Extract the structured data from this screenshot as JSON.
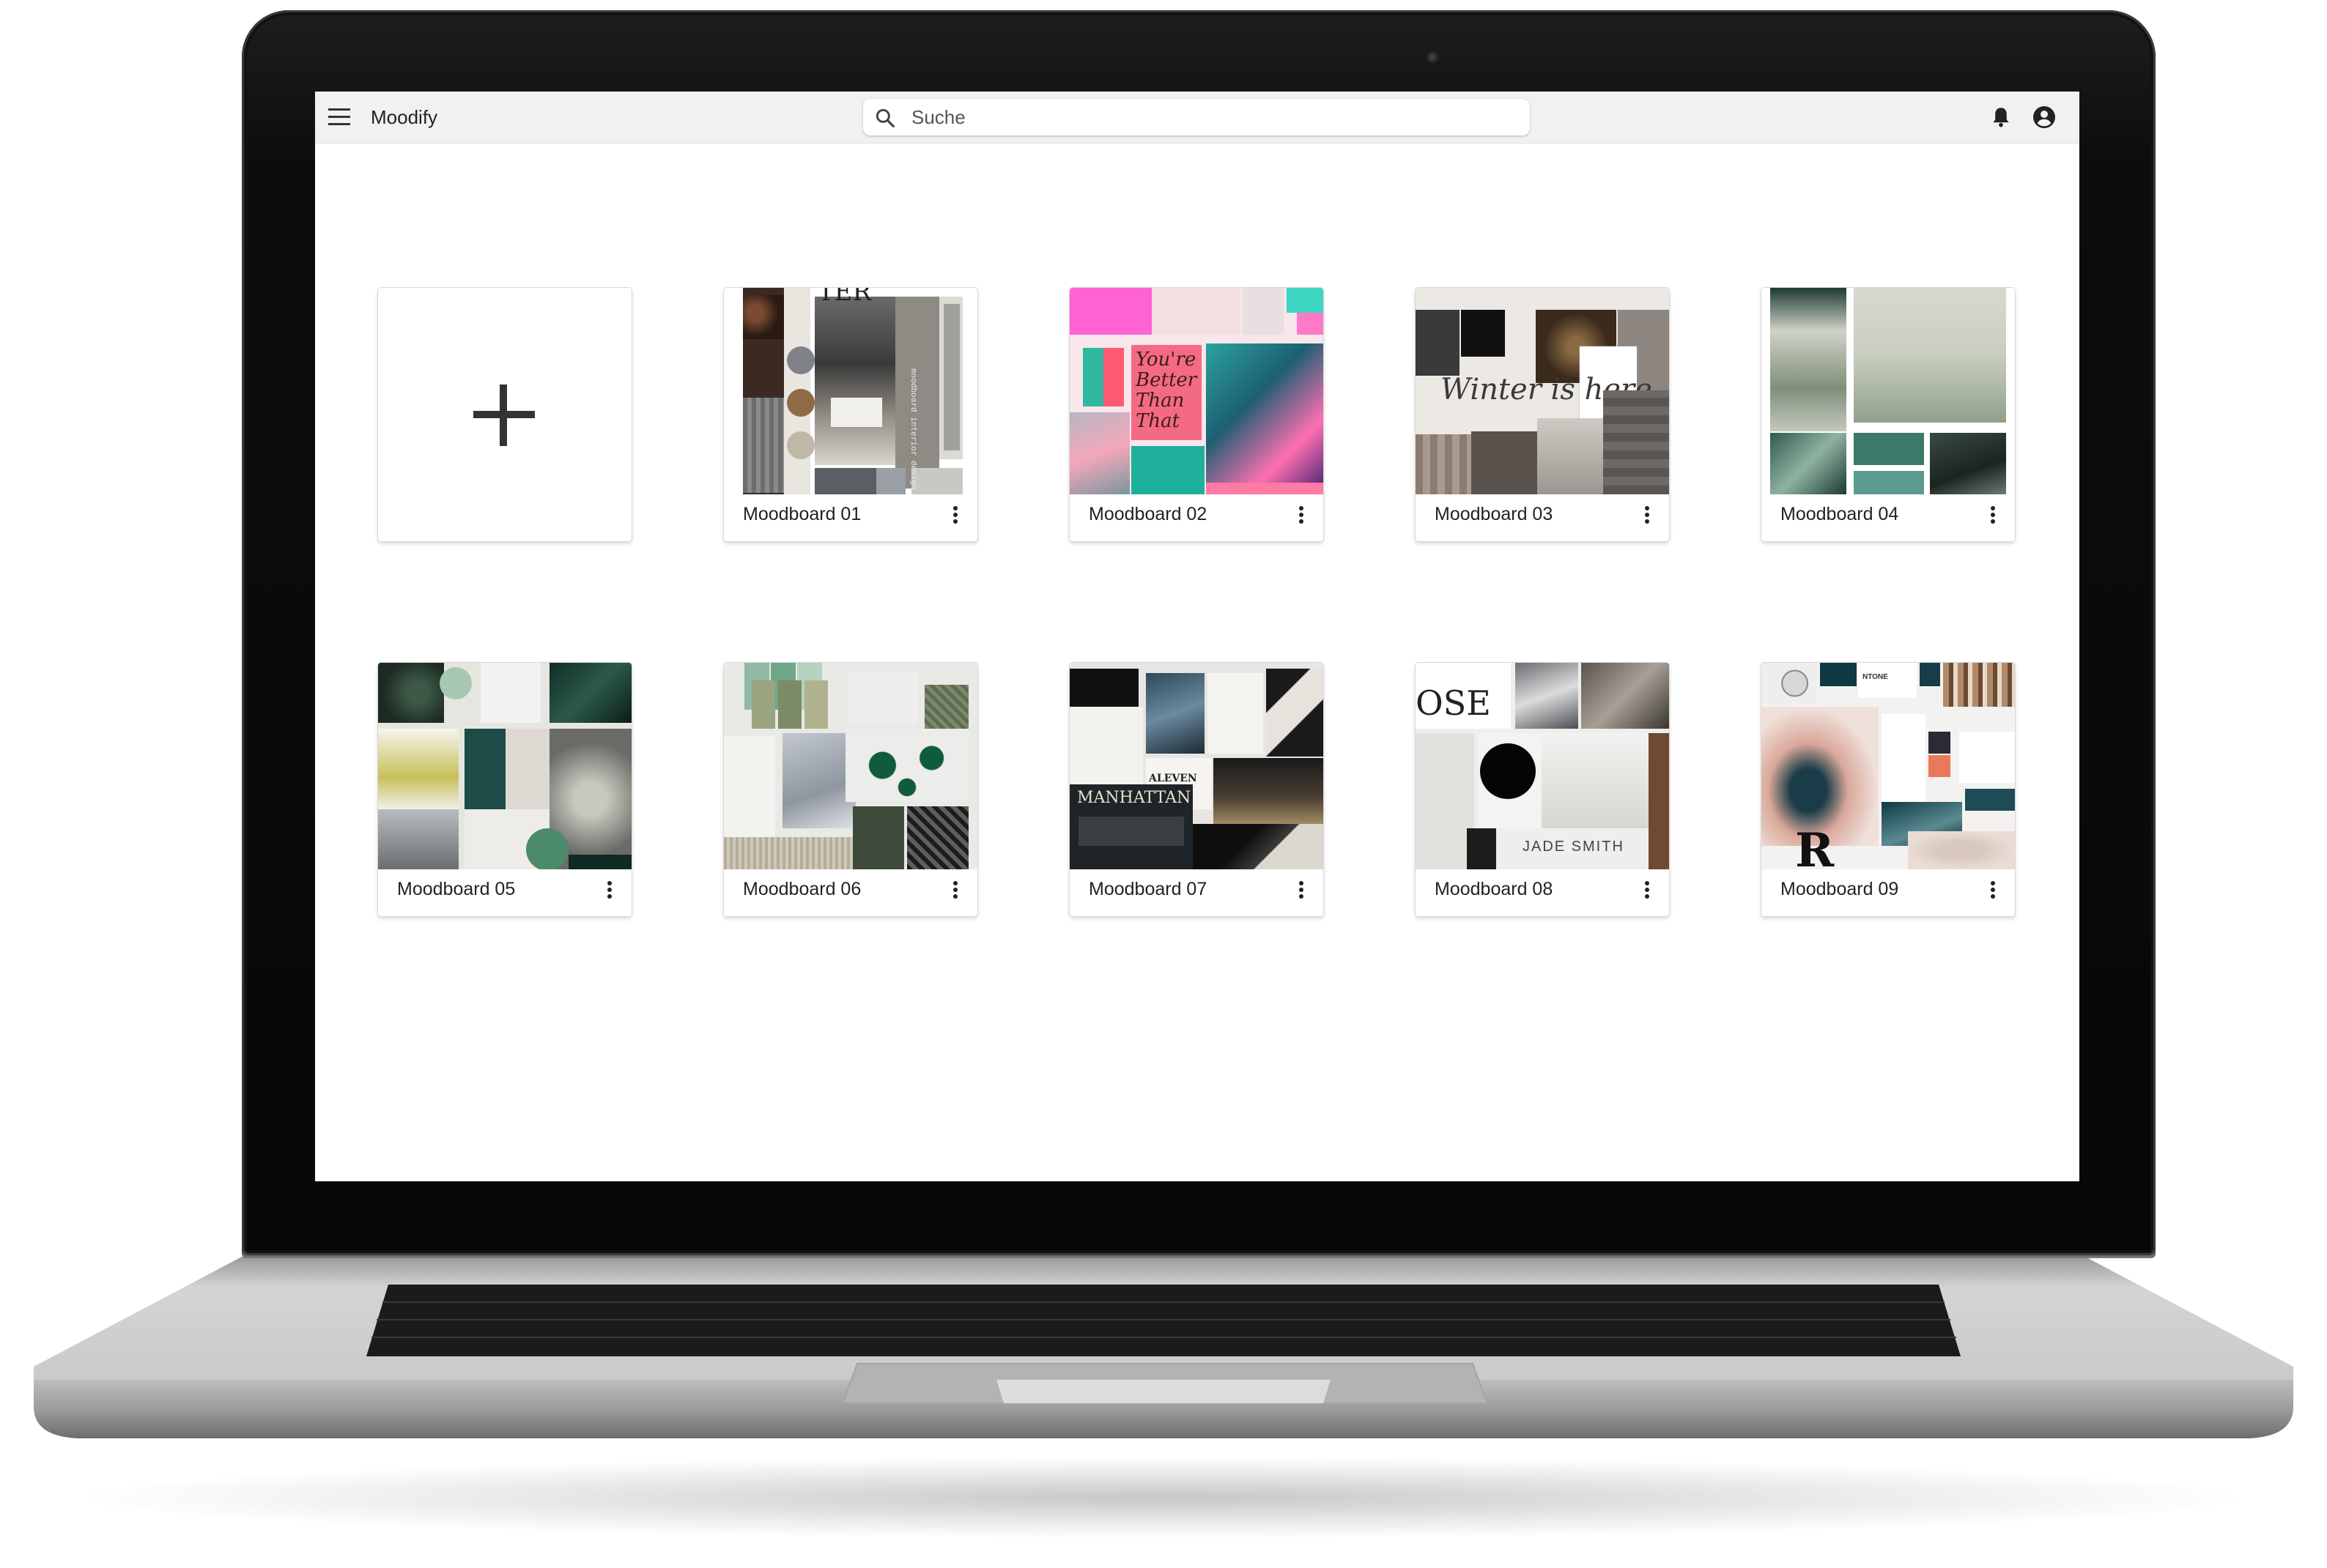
{
  "app": {
    "title": "Moodify"
  },
  "search": {
    "placeholder": "Suche"
  },
  "icons": {
    "menu": "menu-icon",
    "search": "search-icon",
    "notifications": "bell-icon",
    "account": "account-circle-icon",
    "add": "plus-icon",
    "card_menu": "more-vertical-icon"
  },
  "cards": [
    {
      "label": "Moodboard 01",
      "thumb_text": "TER",
      "side_text": "moodboard interior design"
    },
    {
      "label": "Moodboard 02",
      "thumb_text": "You're Better Than That"
    },
    {
      "label": "Moodboard 03",
      "thumb_text": "Winter is here"
    },
    {
      "label": "Moodboard 04"
    },
    {
      "label": "Moodboard 05"
    },
    {
      "label": "Moodboard 06"
    },
    {
      "label": "Moodboard 07",
      "thumb_text": "MANHATTAN",
      "thumb_text_2": "ALEVEN"
    },
    {
      "label": "Moodboard 08",
      "thumb_text": "OSE",
      "thumb_text_2": "JADE SMITH"
    },
    {
      "label": "Moodboard 09",
      "thumb_text": "R",
      "thumb_text_2": "NTONE"
    }
  ],
  "colors": {
    "appbar": "#f1f1f1",
    "screen": "#ffffff",
    "bezel": "#0a0a0a",
    "aluminium": "#c9c9c9"
  }
}
